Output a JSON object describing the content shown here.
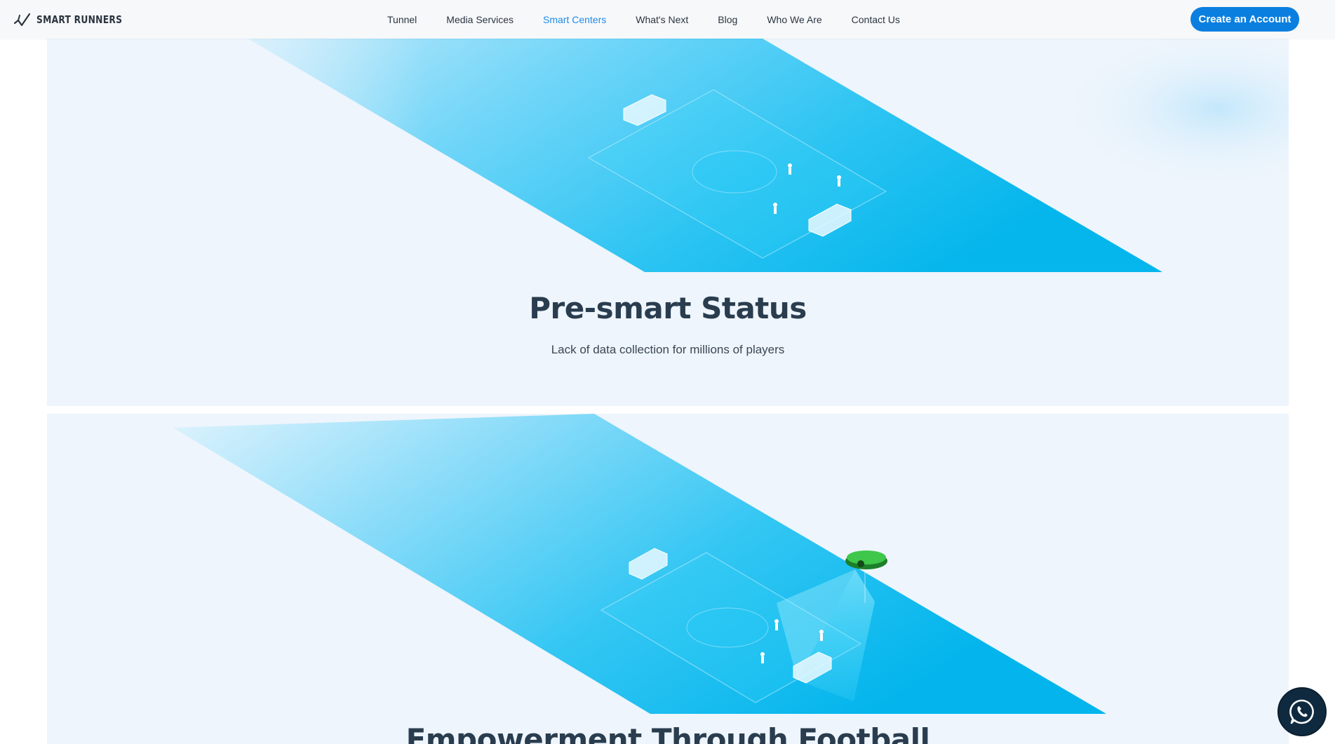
{
  "brand": {
    "name": "SMART RUNNERS",
    "logo_icon": "runner-logo-icon"
  },
  "nav": {
    "items": [
      {
        "label": "Tunnel",
        "active": false
      },
      {
        "label": "Media Services",
        "active": false
      },
      {
        "label": "Smart Centers",
        "active": true
      },
      {
        "label": "What's Next",
        "active": false
      },
      {
        "label": "Blog",
        "active": false
      },
      {
        "label": "Who We Are",
        "active": false
      },
      {
        "label": "Contact Us",
        "active": false
      }
    ],
    "active_color": "#1f8ce8"
  },
  "header": {
    "cta_label": "Create an Account",
    "cta_color": "#0a7fe0"
  },
  "sections": [
    {
      "title": "Pre-smart Status",
      "subtitle": "Lack of data collection for millions of players",
      "illustration": "isometric-football-pitch"
    },
    {
      "title": "Empowerment Through Football",
      "illustration": "isometric-football-pitch-with-camera"
    }
  ],
  "chat_button": {
    "icon": "whatsapp-icon"
  },
  "colors": {
    "panel_bg": "#eef5fc",
    "beam": "#0ab8ef",
    "title": "#2a3d4f"
  }
}
